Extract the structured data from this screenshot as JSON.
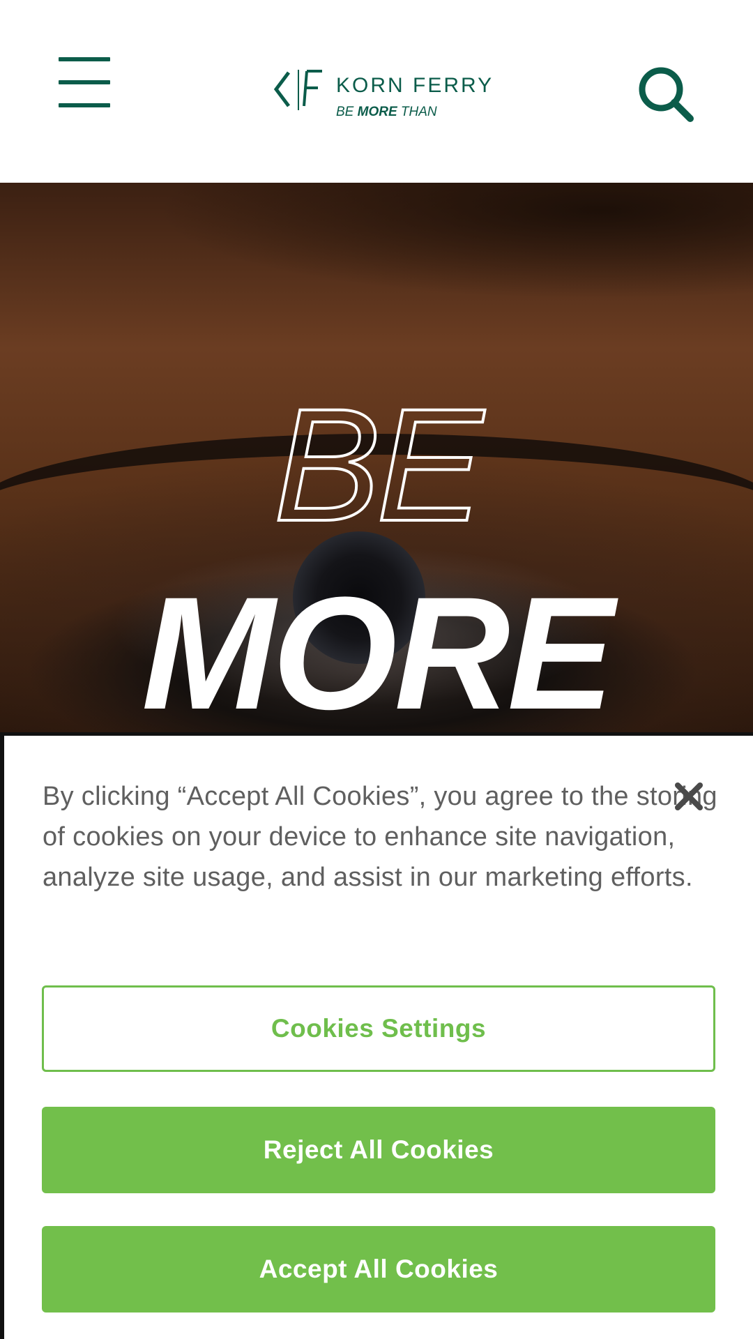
{
  "header": {
    "logo": {
      "name": "KORN FERRY",
      "tagline_prefix": "BE",
      "tagline_bold": "MORE",
      "tagline_suffix": "THAN"
    },
    "menu_icon": "hamburger-menu-icon",
    "search_icon": "search-icon"
  },
  "hero": {
    "line1": "BE",
    "line2": "MORE"
  },
  "cookie_banner": {
    "text": "By clicking “Accept All Cookies”, you agree to the storing of cookies on your device to enhance site navigation, analyze site usage, and assist in our marketing efforts.",
    "close_icon": "close-icon",
    "settings_label": "Cookies Settings",
    "reject_label": "Reject All Cookies",
    "accept_label": "Accept All Cookies"
  },
  "colors": {
    "brand_green": "#0b5c4a",
    "cookie_green": "#72bf4b",
    "text_gray": "#5f5f5f"
  }
}
